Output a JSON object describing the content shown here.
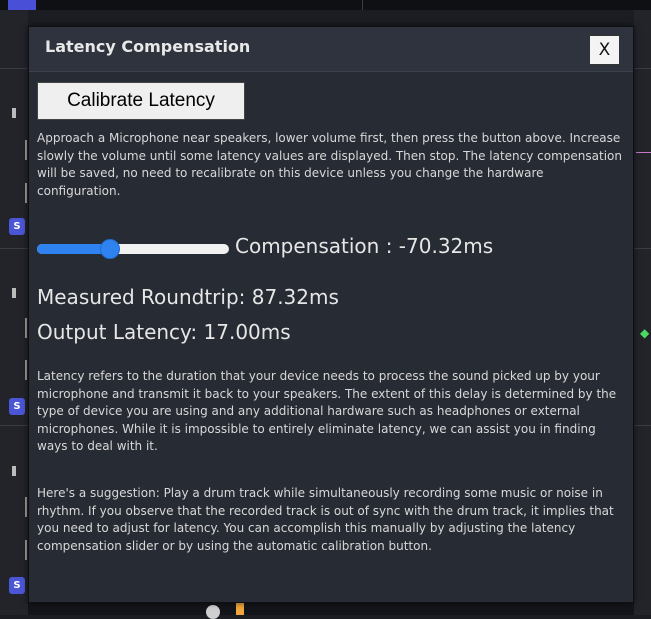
{
  "dialog": {
    "title": "Latency Compensation",
    "close_label": "X",
    "calibrate_label": "Calibrate Latency",
    "instructions": "Approach a Microphone near speakers, lower volume first, then press the button above. Increase slowly the volume until some latency values are displayed. Then stop. The latency compensation will be saved, no need to recalibrate on this device unless you change the hardware configuration.",
    "slider": {
      "fraction": 0.38,
      "label": "Compensation : -70.32ms"
    },
    "measured_roundtrip": "Measured Roundtrip: 87.32ms",
    "output_latency": "Output Latency: 17.00ms",
    "explanation": "Latency refers to the duration that your device needs to process the sound picked up by your microphone and transmit it back to your speakers. The extent of this delay is determined by the type of device you are using and any additional hardware such as headphones or external microphones. While it is impossible to entirely eliminate latency, we can assist you in finding ways to deal with it.",
    "suggestion": "Here's a suggestion: Play a drum track while simultaneously recording some music or noise in rhythm. If you observe that the recorded track is out of sync with the drum track, it implies that you need to adjust for latency. You can accomplish this manually by adjusting the latency compensation slider or by using the automatic calibration button."
  },
  "background": {
    "track_badge": "S",
    "colors": {
      "accent": "#4b56d6",
      "slider": "#2e83f0",
      "orange": "#f0a63a"
    }
  }
}
